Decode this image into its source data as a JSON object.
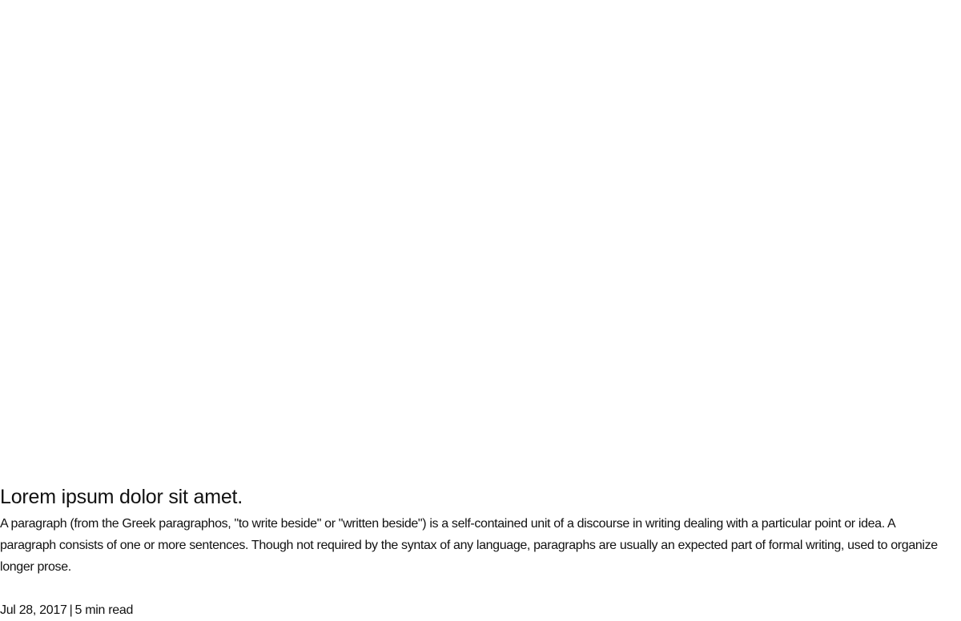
{
  "article": {
    "title": "Lorem ipsum dolor sit amet.",
    "body": "A paragraph (from the Greek paragraphos, \"to write beside\" or \"written beside\") is a self-contained unit of a discourse in writing dealing with a particular point or idea. A paragraph consists of one or more sentences. Though not required by the syntax of any language, paragraphs are usually an expected part of formal writing, used to organize longer prose.",
    "date": "Jul 28, 2017",
    "separator": "|",
    "read_time": "5 min read"
  }
}
